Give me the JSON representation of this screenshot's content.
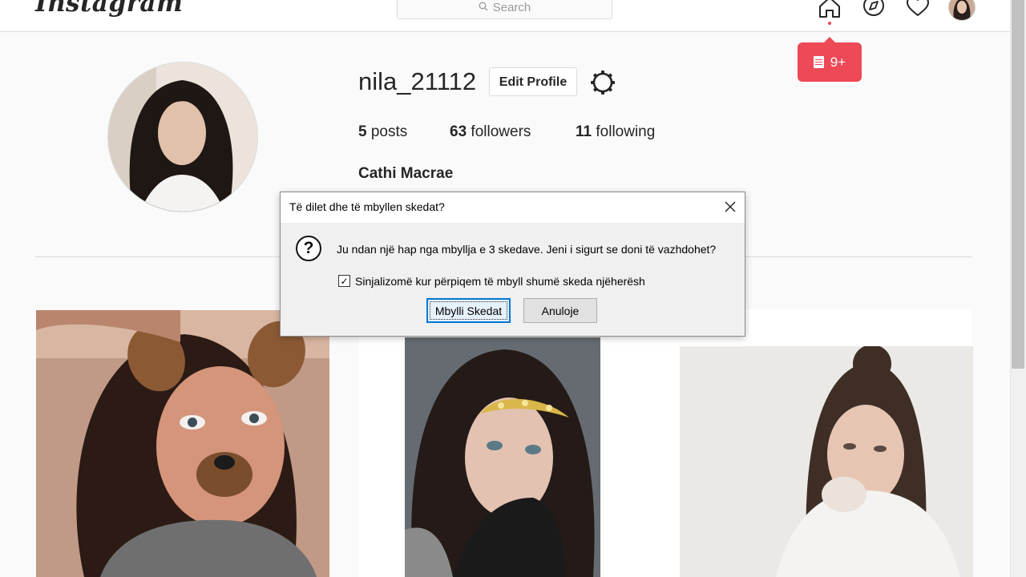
{
  "nav": {
    "logo": "Instagram",
    "search_placeholder": "Search",
    "icons": [
      "home-icon",
      "explore-icon",
      "heart-icon",
      "avatar"
    ],
    "notification_badge": "9+"
  },
  "profile": {
    "username": "nila_21112",
    "edit_label": "Edit Profile",
    "posts_count": "5",
    "posts_label": "posts",
    "followers_count": "63",
    "followers_label": "followers",
    "following_count": "11",
    "following_label": "following",
    "full_name": "Cathi Macrae"
  },
  "dialog": {
    "title": "Të dilet dhe të mbyllen skedat?",
    "message": "Ju ndan një hap nga mbyllja e 3 skedave. Jeni i sigurt se doni të vazhdohet?",
    "checkbox_label": "Sinjalizomë kur përpiqem të mbyll shumë skeda njëherësh",
    "checkbox_checked": true,
    "confirm_label": "Mbylli Skedat",
    "cancel_label": "Anuloje"
  },
  "colors": {
    "accent_red": "#ed4956",
    "dialog_focus": "#0078d7"
  }
}
